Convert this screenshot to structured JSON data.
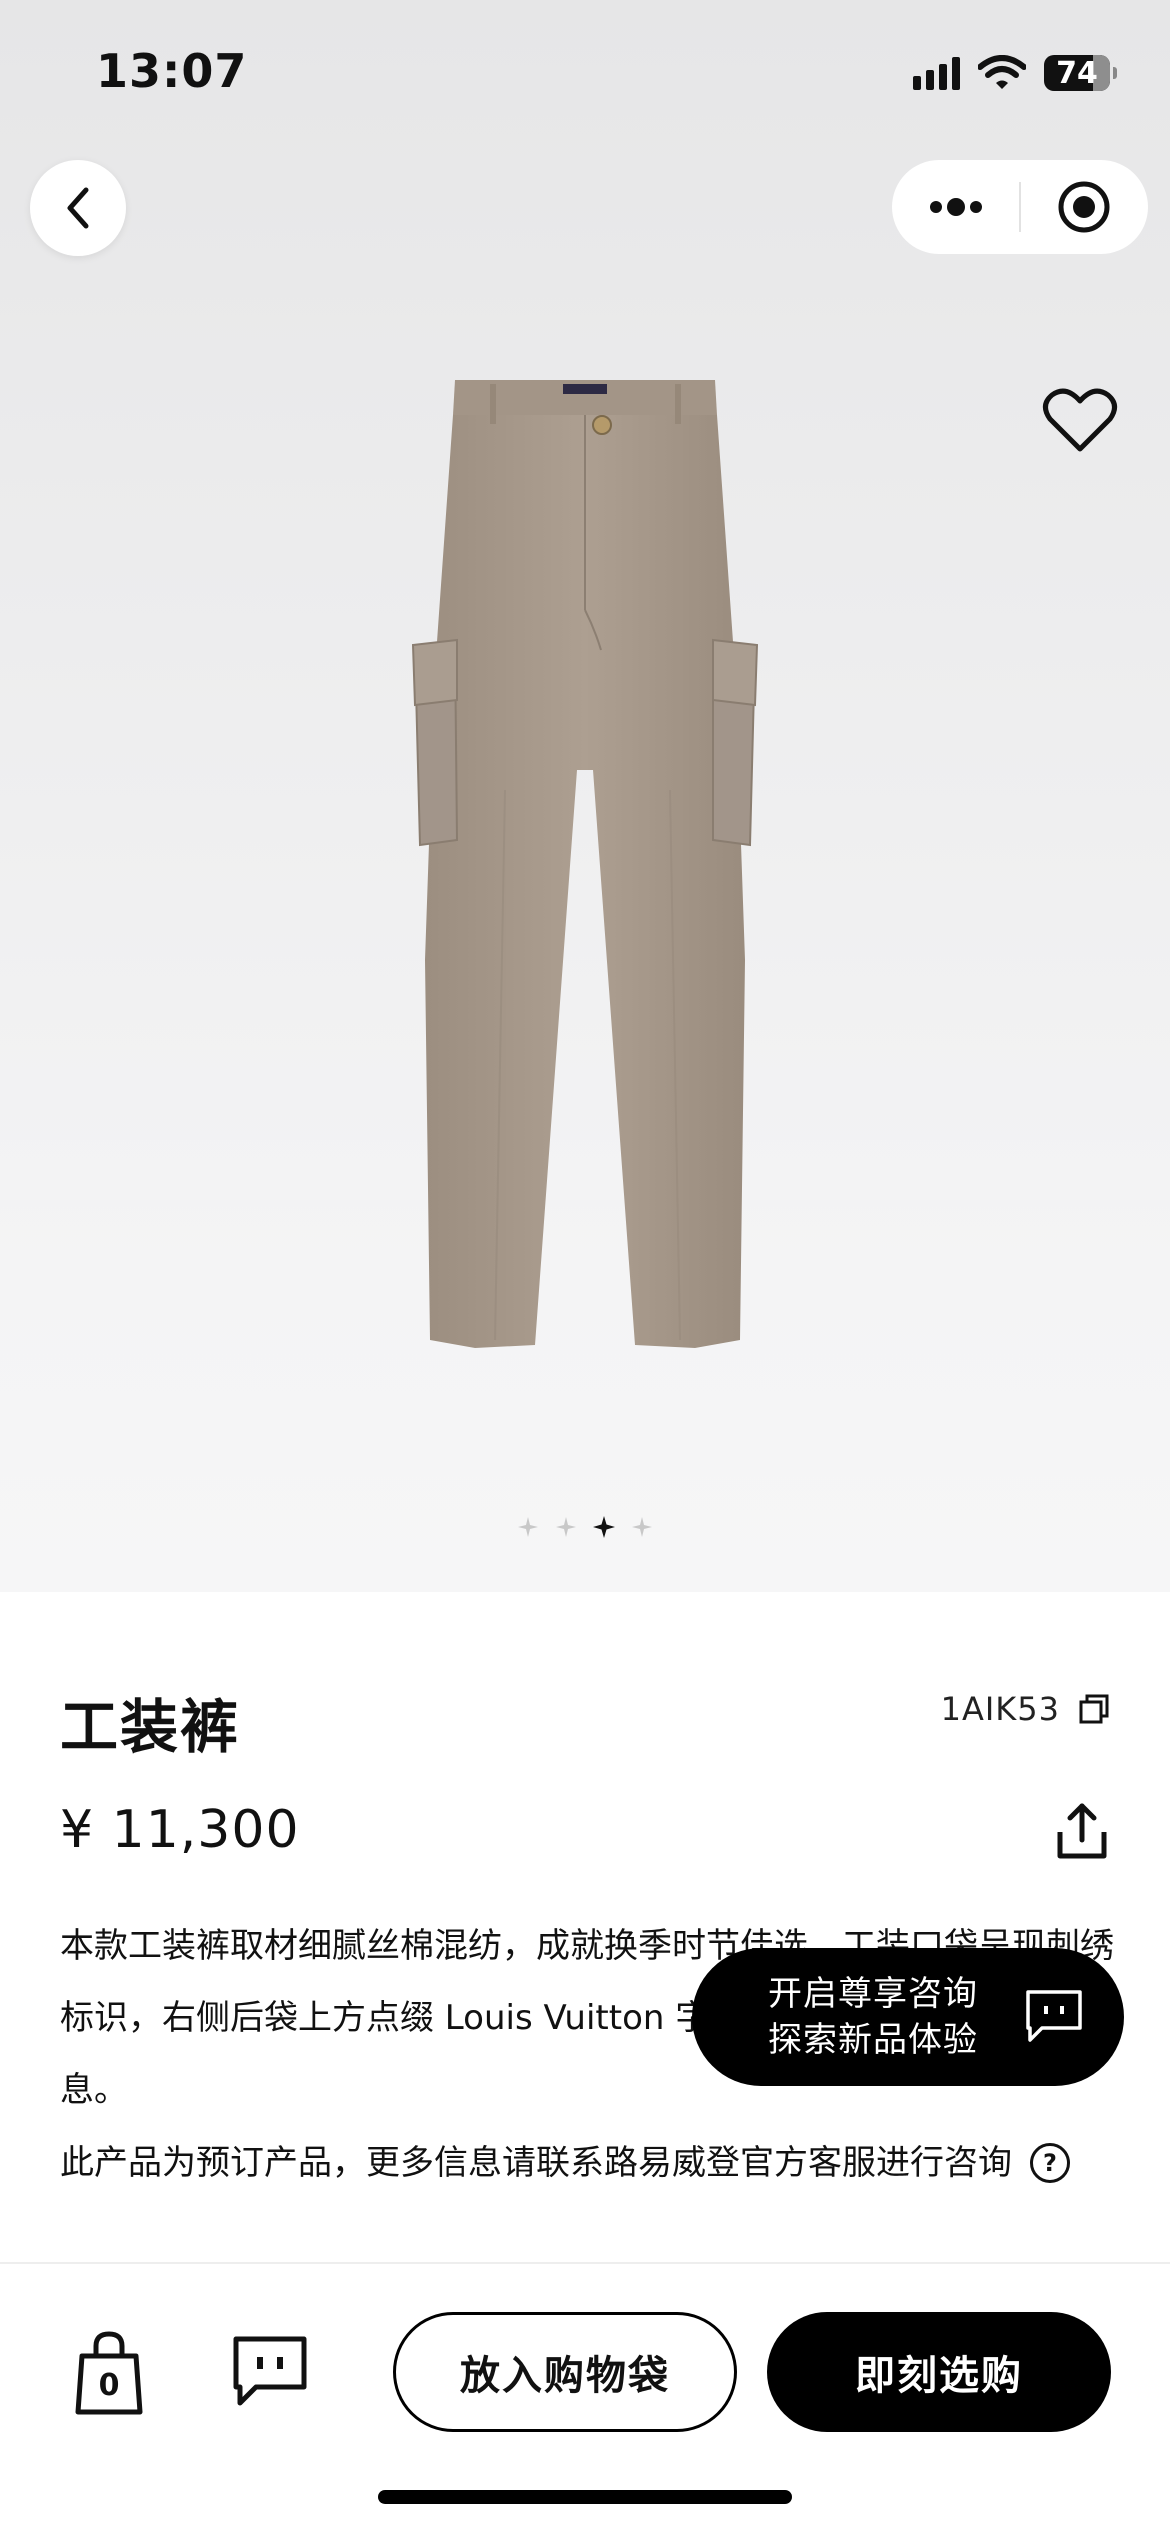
{
  "status_bar": {
    "time": "13:07",
    "battery": "74"
  },
  "nav": {
    "back_icon": "chevron-left-icon",
    "more_icon": "more-dots-icon",
    "close_icon": "target-circle-icon",
    "favorite_icon": "heart-outline-icon"
  },
  "gallery": {
    "image_alt": "cargo-pants-image",
    "slide_count": 4,
    "active_index": 2
  },
  "product": {
    "title": "工装裤",
    "sku": "1AIK53",
    "copy_icon": "copy-icon",
    "price": "¥ 11,300",
    "share_icon": "share-icon",
    "description": "本款工装裤取材细腻丝棉混纺，成就换季时节佳选。工装口袋呈现刺绣标识，右侧后袋上方点缀 Louis Vuitton 字样，为利落版型注入考究气息。",
    "preorder_notice": "此产品为预订产品，更多信息请联系路易威登官方客服进行咨询",
    "help_icon": "help-circle-icon"
  },
  "consult_bubble": {
    "line1": "开启尊享咨询",
    "line2": "探索新品体验",
    "icon": "chat-bubble-icon"
  },
  "bottom_bar": {
    "bag_count": "0",
    "bag_icon": "shopping-bag-icon",
    "chat_icon": "message-icon",
    "add_to_bag_label": "放入购物袋",
    "buy_now_label": "即刻选购"
  },
  "colors": {
    "accent": "#000000",
    "hero_background": "#ececed",
    "pants": "#a89a8c"
  }
}
